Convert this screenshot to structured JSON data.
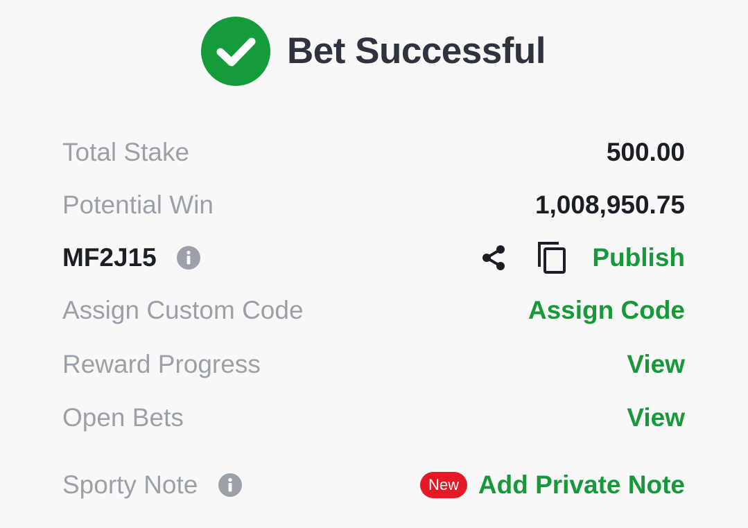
{
  "header": {
    "title": "Bet Successful",
    "icon": "check-circle-icon"
  },
  "summary": {
    "total_stake": {
      "label": "Total Stake",
      "value": "500.00"
    },
    "potential_win": {
      "label": "Potential Win",
      "value": "1,008,950.75"
    }
  },
  "booking": {
    "code": "MF2J15",
    "share_icon": "share-icon",
    "copy_icon": "copy-icon",
    "publish_label": "Publish"
  },
  "custom_code": {
    "label": "Assign Custom Code",
    "action": "Assign Code"
  },
  "reward_progress": {
    "label": "Reward Progress",
    "action": "View"
  },
  "open_bets": {
    "label": "Open Bets",
    "action": "View"
  },
  "sporty_note": {
    "label": "Sporty Note",
    "badge": "New",
    "action": "Add Private Note"
  },
  "colors": {
    "accent_green": "#17993a",
    "badge_red": "#e41827",
    "muted_text": "#9ca0a8",
    "dark_text": "#1b1e24"
  }
}
